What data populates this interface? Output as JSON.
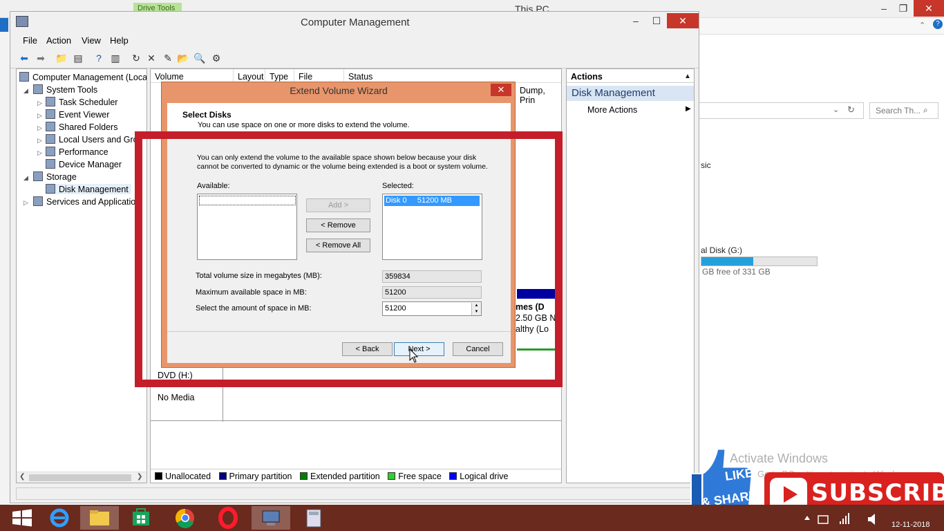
{
  "bg_window": {
    "title": "This PC",
    "drive_tools_tab": "Drive Tools",
    "search_placeholder": "Search Th...",
    "basic_text": "sic",
    "disk_label": "al Disk (G:)",
    "disk_free": "GB free of 331 GB",
    "disk_used_fraction": 0.45
  },
  "cm": {
    "title": "Computer Management",
    "menu": [
      "File",
      "Action",
      "View",
      "Help"
    ],
    "tree": [
      {
        "label": "Computer Management (Local",
        "icon": "computer-icon"
      },
      {
        "label": "System Tools",
        "icon": "tools-icon"
      },
      {
        "label": "Task Scheduler",
        "icon": "clock-icon"
      },
      {
        "label": "Event Viewer",
        "icon": "event-viewer-icon"
      },
      {
        "label": "Shared Folders",
        "icon": "shared-folder-icon"
      },
      {
        "label": "Local Users and Grou",
        "icon": "users-icon"
      },
      {
        "label": "Performance",
        "icon": "performance-icon"
      },
      {
        "label": "Device Manager",
        "icon": "device-manager-icon"
      },
      {
        "label": "Storage",
        "icon": "storage-icon"
      },
      {
        "label": "Disk Management",
        "icon": "disk-icon"
      },
      {
        "label": "Services and Application",
        "icon": "services-icon"
      }
    ],
    "columns": [
      "Volume",
      "Layout",
      "Type",
      "File System",
      "Status"
    ],
    "status_partial": "Dump, Prin",
    "partial_lines": [
      "mes (D",
      "2.50 GB N",
      "althy (Lo"
    ],
    "dvd_label": "DVD (H:)",
    "no_media": "No Media",
    "legend": [
      {
        "label": "Unallocated",
        "color": "#000000"
      },
      {
        "label": "Primary partition",
        "color": "#000080"
      },
      {
        "label": "Extended partition",
        "color": "#008000"
      },
      {
        "label": "Free space",
        "color": "#33cc33"
      },
      {
        "label": "Logical drive",
        "color": "#0000ff"
      }
    ],
    "actions": {
      "header": "Actions",
      "group": "Disk Management",
      "more": "More Actions"
    }
  },
  "wizard": {
    "title": "Extend Volume Wizard",
    "header_title": "Select Disks",
    "header_subtitle": "You can use space on one or more disks to extend the volume.",
    "description": "You can only extend the volume to the available space shown below because your disk cannot be converted to dynamic or the volume being extended is a boot or system volume.",
    "available_label": "Available:",
    "selected_label": "Selected:",
    "selected_item": "Disk 0     51200 MB",
    "add_label": "Add >",
    "remove_label": "< Remove",
    "remove_all_label": "< Remove All",
    "total_label": "Total volume size in megabytes (MB):",
    "total_value": "359834",
    "max_label": "Maximum available space in MB:",
    "max_value": "51200",
    "amount_label": "Select the amount of space in MB:",
    "amount_value": "51200",
    "back_label": "< Back",
    "next_label": "Next >",
    "cancel_label": "Cancel"
  },
  "watermark": {
    "line1": "Activate Windows",
    "line2": "Go to PC settings to activate Windows."
  },
  "overlay": {
    "like_text": "LIKE",
    "share_text": "& SHARE",
    "subscribe_text": "SUBSCRIBE"
  },
  "taskbar": {
    "date": "12-11-2018"
  }
}
